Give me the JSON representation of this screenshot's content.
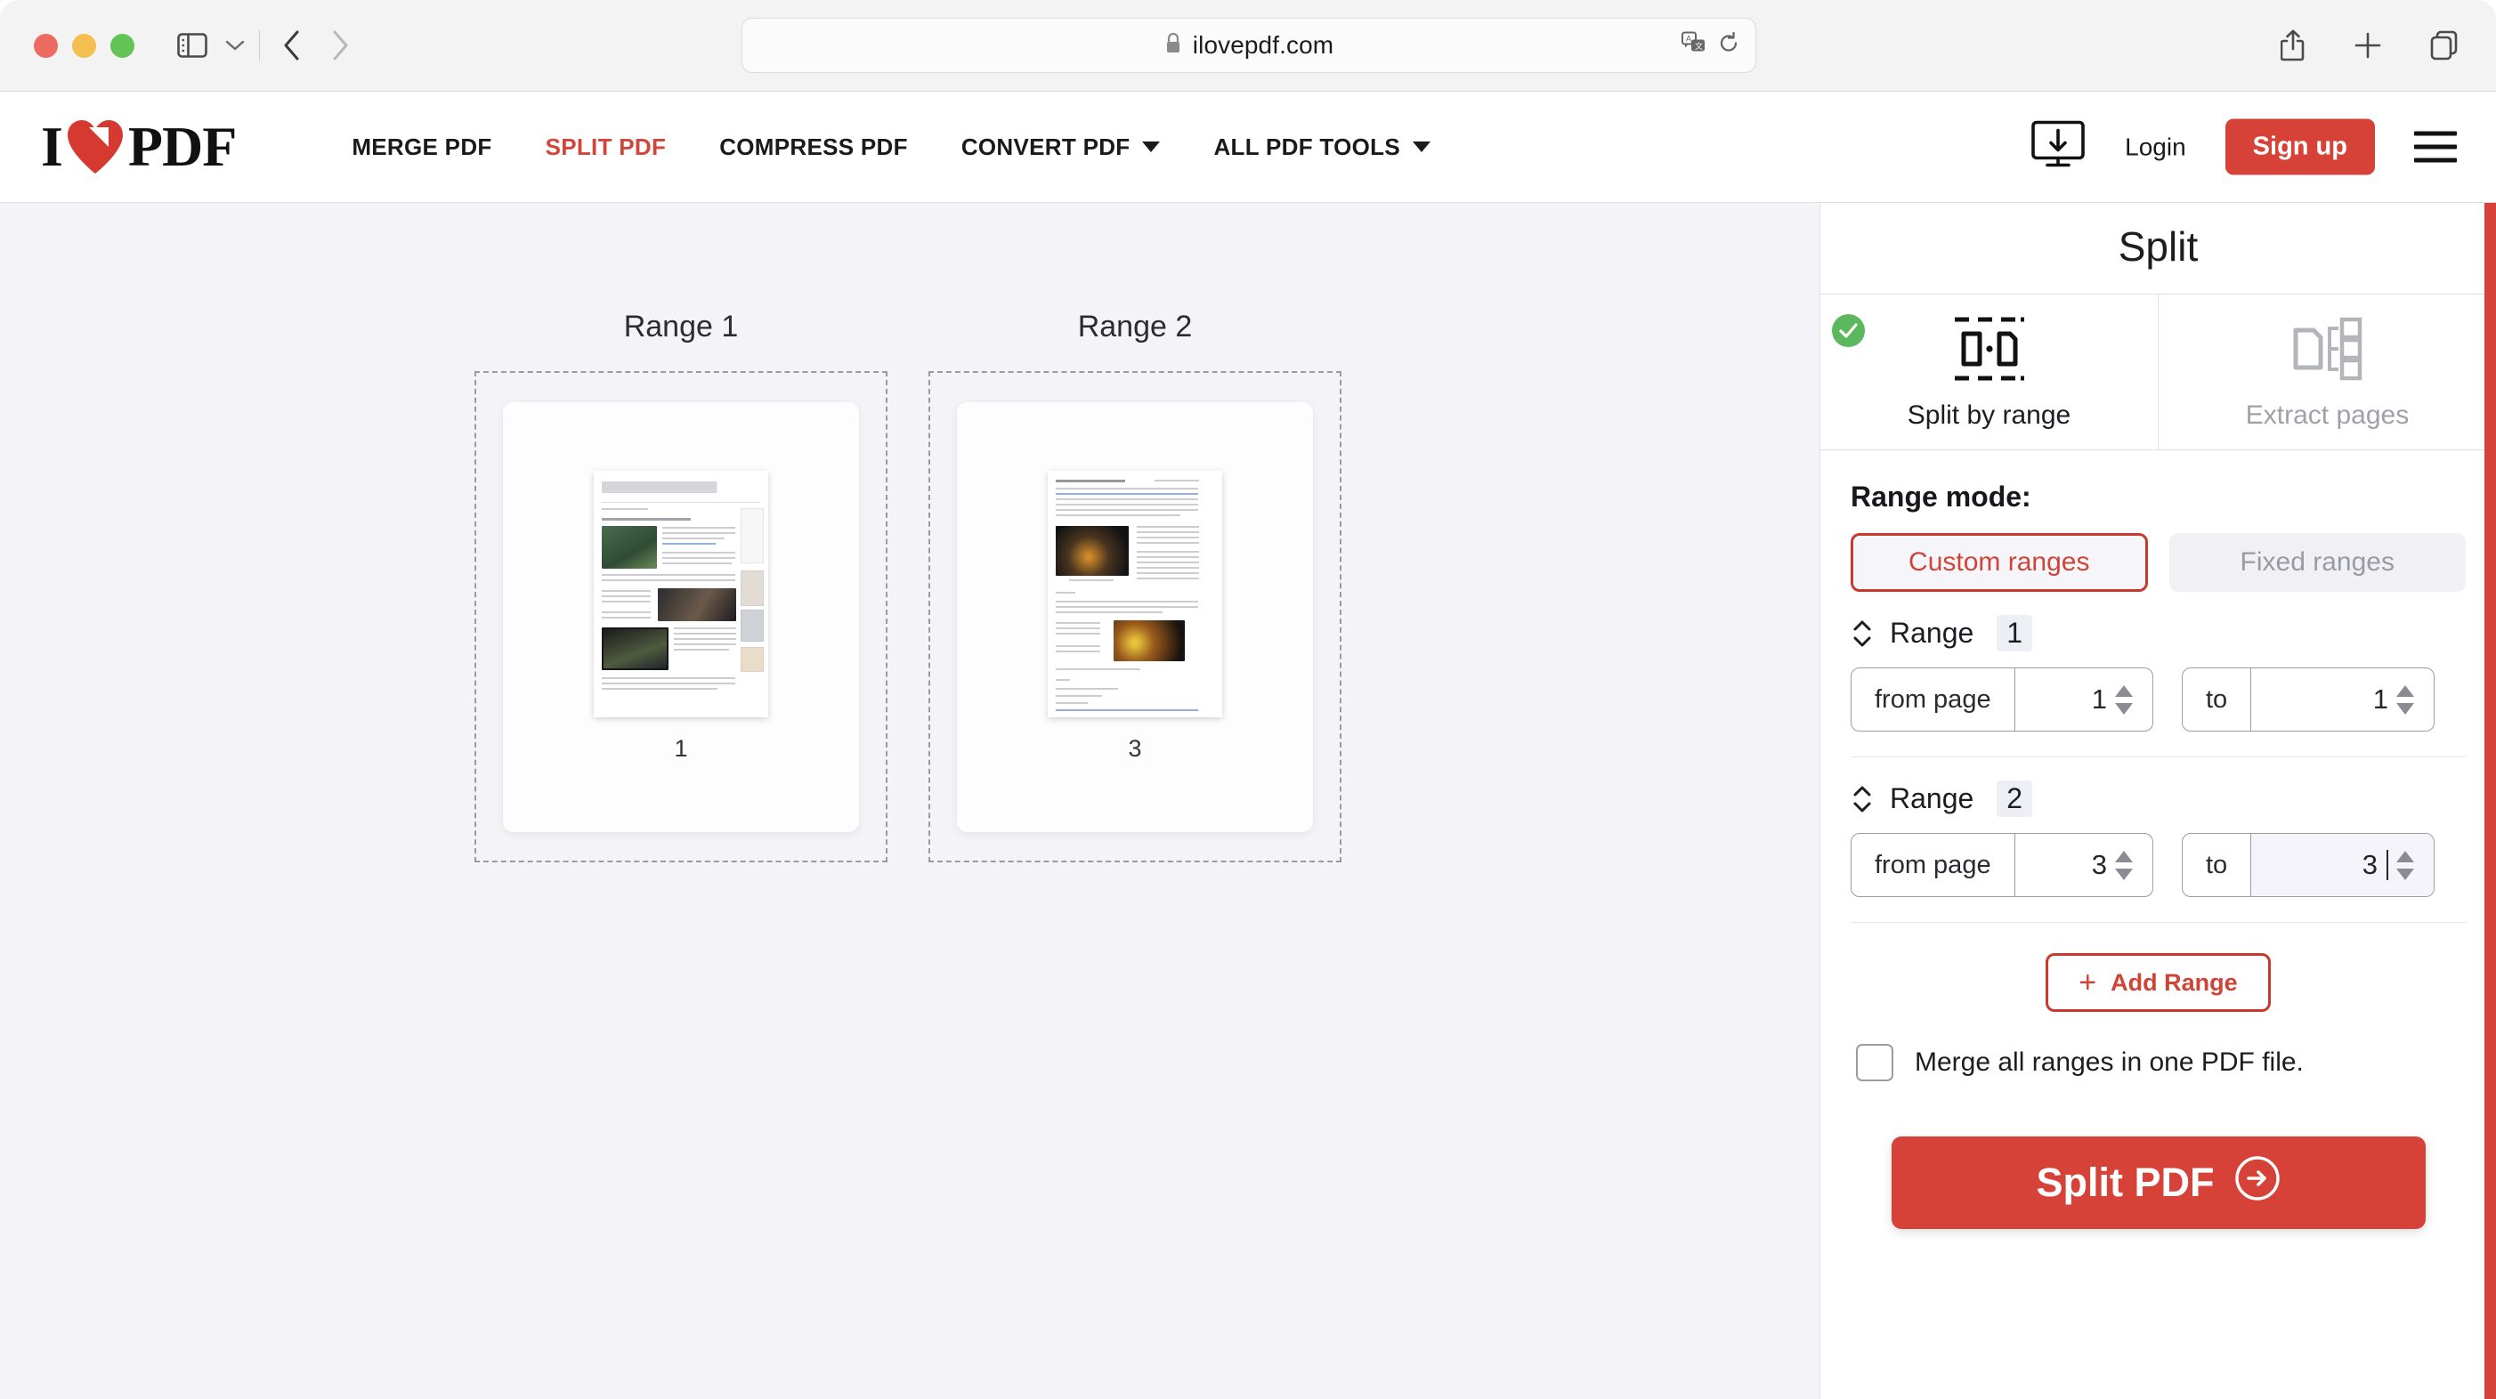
{
  "browser": {
    "url": "ilovepdf.com",
    "icons": {
      "lock": "lock-icon",
      "sidebar_toggle": "sidebar-toggle-icon",
      "chevron_down": "chevron-down-icon",
      "back": "back-arrow-icon",
      "forward": "forward-arrow-icon",
      "translate": "translate-icon",
      "reload": "reload-icon",
      "share": "share-icon",
      "new_tab": "plus-icon",
      "tabs_overview": "tabs-overview-icon"
    },
    "traffic_lights": {
      "close": "#ec6a5f",
      "minimize": "#f4bf50",
      "zoom": "#61c454"
    }
  },
  "site_nav": {
    "logo_text_left": "I",
    "logo_text_right": "PDF",
    "links": [
      {
        "label": "MERGE PDF",
        "active": false,
        "dropdown": false
      },
      {
        "label": "SPLIT PDF",
        "active": true,
        "dropdown": false
      },
      {
        "label": "COMPRESS PDF",
        "active": false,
        "dropdown": false
      },
      {
        "label": "CONVERT PDF",
        "active": false,
        "dropdown": true
      },
      {
        "label": "ALL PDF TOOLS",
        "active": false,
        "dropdown": true
      }
    ],
    "login_label": "Login",
    "signup_label": "Sign up",
    "desktop_icon": "desktop-download-icon",
    "menu_icon": "hamburger-menu-icon",
    "accent_color": "#d64238"
  },
  "workspace": {
    "ranges": [
      {
        "title": "Range 1",
        "page_number": "1"
      },
      {
        "title": "Range 2",
        "page_number": "3"
      }
    ]
  },
  "sidebar": {
    "title": "Split",
    "tool_tabs": [
      {
        "label": "Split by range",
        "selected": true,
        "icon": "split-by-range-icon"
      },
      {
        "label": "Extract pages",
        "selected": false,
        "icon": "extract-pages-icon"
      }
    ],
    "range_mode_label": "Range mode:",
    "mode_buttons": [
      {
        "label": "Custom ranges",
        "selected": true
      },
      {
        "label": "Fixed ranges",
        "selected": false
      }
    ],
    "range_rows": [
      {
        "label": "Range",
        "index": "1",
        "from_label": "from page",
        "from_value": "1",
        "to_label": "to",
        "to_value": "1",
        "to_focused": false
      },
      {
        "label": "Range",
        "index": "2",
        "from_label": "from page",
        "from_value": "3",
        "to_label": "to",
        "to_value": "3",
        "to_focused": true
      }
    ],
    "add_range_label": "Add Range",
    "add_range_plus": "+",
    "merge_checkbox_label": "Merge all ranges in one PDF file.",
    "merge_checked": false,
    "split_button_label": "Split PDF",
    "accent_color": "#d64238",
    "check_badge_color": "#5cb85c"
  }
}
